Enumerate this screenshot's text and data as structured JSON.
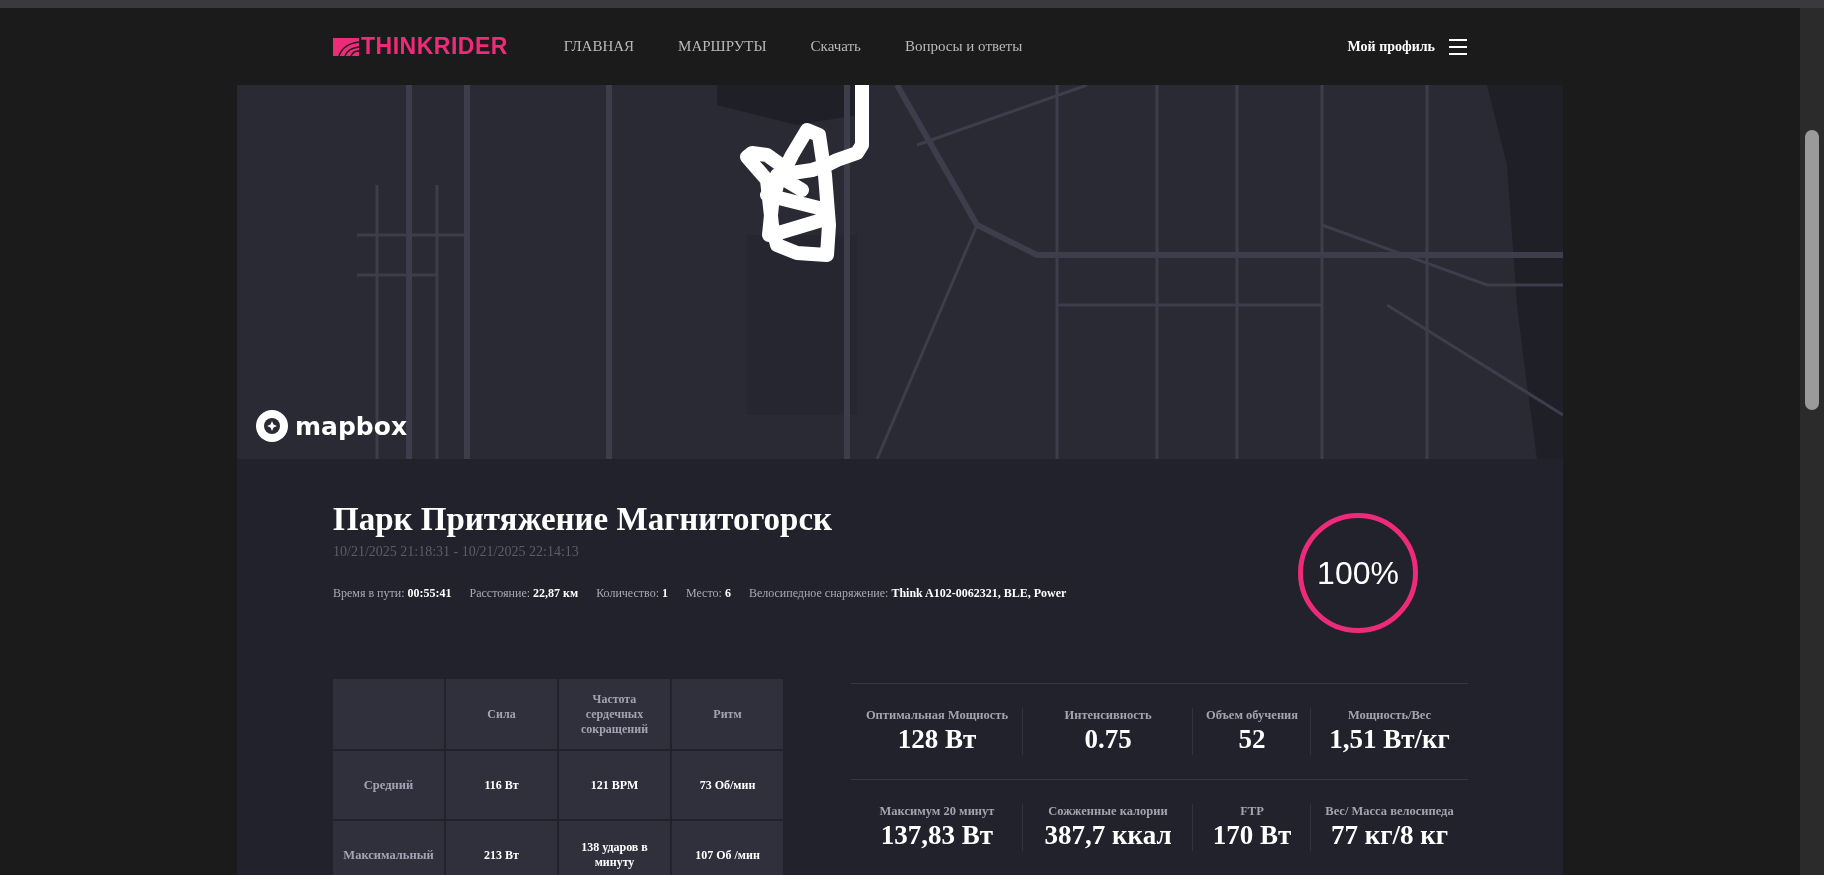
{
  "header": {
    "logo": "THINKRIDER",
    "nav": [
      "ГЛАВНАЯ",
      "МАРШРУТЫ",
      "Скачать",
      "Вопросы и ответы"
    ],
    "profile": "Мой профиль"
  },
  "map": {
    "attribution": "mapbox"
  },
  "ride": {
    "title": "Парк Притяжение Магнитогорск",
    "period": "10/21/2025 21:18:31 - 10/21/2025 22:14:13",
    "completion": "100%",
    "stats": [
      {
        "label": "Время в пути:",
        "value": "00:55:41"
      },
      {
        "label": "Расстояние:",
        "value": "22,87 км"
      },
      {
        "label": "Количество:",
        "value": "1"
      },
      {
        "label": "Место:",
        "value": "6"
      },
      {
        "label": "Велосипедное снаряжение:",
        "value": "Think A102-0062321, BLE, Power"
      }
    ]
  },
  "table": {
    "columns": [
      "Сила",
      "Частота сердечных сокращений",
      "Ритм"
    ],
    "rows": [
      {
        "label": "Средний",
        "cells": [
          "116 Вт",
          "121 BPM",
          "73 Об/мин"
        ]
      },
      {
        "label": "Максимальный",
        "cells": [
          "213 Вт",
          "138 ударов в минуту",
          "107 Об /мин"
        ]
      }
    ]
  },
  "metrics": [
    {
      "label": "Оптимальная Мощность",
      "value": "128 Вт"
    },
    {
      "label": "Интенсивность",
      "value": "0.75"
    },
    {
      "label": "Объем обучения",
      "value": "52"
    },
    {
      "label": "Мощность/Вес",
      "value": "1,51 Вт/кг"
    },
    {
      "label": "Максимум 20 минут",
      "value": "137,83 Вт"
    },
    {
      "label": "Сожженные калории",
      "value": "387,7 ккал"
    },
    {
      "label": "FTP",
      "value": "170 Вт"
    },
    {
      "label": "Вес/ Масса велосипеда",
      "value": "77 кг/8 кг"
    }
  ]
}
